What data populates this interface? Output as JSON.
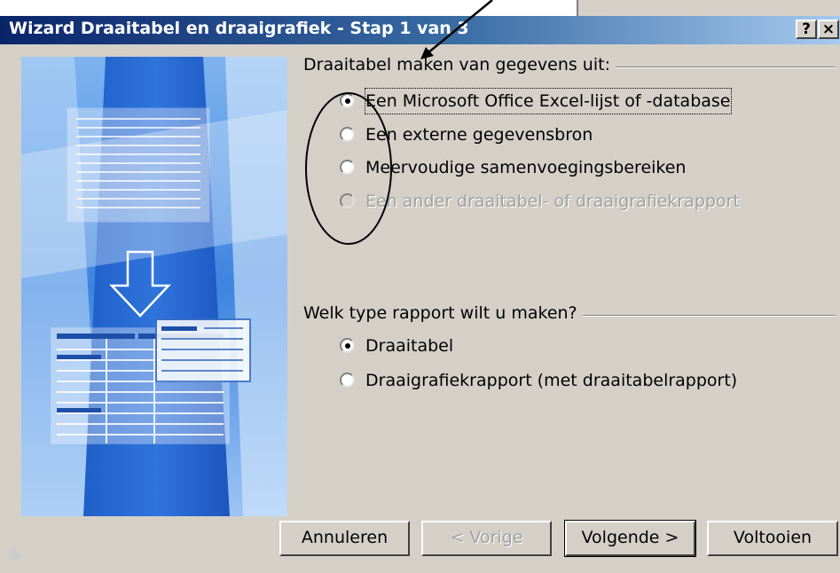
{
  "window": {
    "title": "Wizard Draaitabel en draaigrafiek - Stap 1 van 3",
    "help_button": "?",
    "close_button": "×"
  },
  "source_group": {
    "title": "Draaitabel maken van gegevens uit:",
    "options": [
      {
        "label": "Een Microsoft Office Excel-lijst of -database",
        "selected": true,
        "enabled": true
      },
      {
        "label": "Een externe gegevensbron",
        "selected": false,
        "enabled": true
      },
      {
        "label": "Meervoudige samenvoegingsbereiken",
        "selected": false,
        "enabled": true
      },
      {
        "label": "Een ander draaitabel- of draaigrafiekrapport",
        "selected": false,
        "enabled": false
      }
    ]
  },
  "report_group": {
    "title": "Welk type rapport wilt u maken?",
    "options": [
      {
        "label": "Draaitabel",
        "selected": true,
        "enabled": true
      },
      {
        "label": "Draaigrafiekrapport (met draaitabelrapport)",
        "selected": false,
        "enabled": true
      }
    ]
  },
  "buttons": {
    "cancel": "Annuleren",
    "previous": "< Vorige",
    "next": "Volgende >",
    "finish": "Voltooien"
  },
  "colors": {
    "titlebar_start": "#0a246a",
    "titlebar_end": "#a6caf0",
    "dialog_face": "#d4d0c8",
    "illustration_blue": "#2b6fd6"
  }
}
